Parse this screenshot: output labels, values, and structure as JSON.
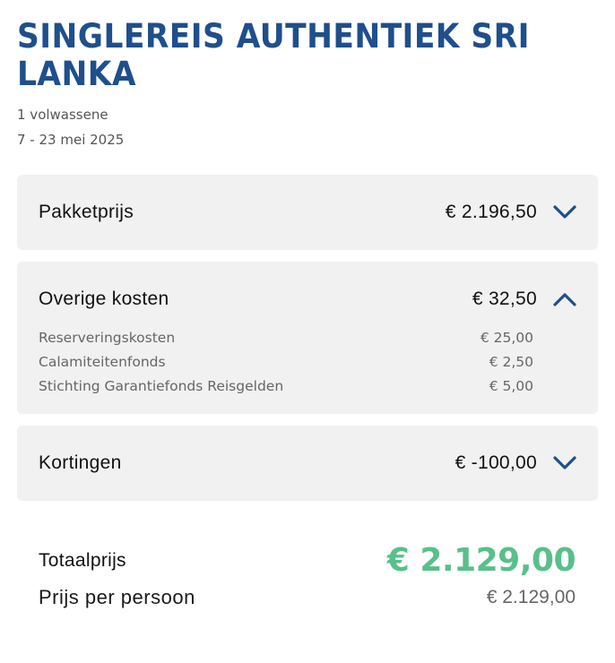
{
  "trip": {
    "title": "SINGLEREIS AUTHENTIEK SRI LANKA",
    "travelers": "1 volwassene",
    "dates": "7 - 23 mei 2025"
  },
  "sections": [
    {
      "label": "Pakketprijs",
      "amount": "€ 2.196,50",
      "expanded": false,
      "icon": "chevron-down-icon"
    },
    {
      "label": "Overige kosten",
      "amount": "€ 32,50",
      "expanded": true,
      "icon": "chevron-up-icon",
      "items": [
        {
          "label": "Reserveringskosten",
          "amount": "€ 25,00"
        },
        {
          "label": "Calamiteitenfonds",
          "amount": "€ 2,50"
        },
        {
          "label": "Stichting Garantiefonds Reisgelden",
          "amount": "€ 5,00"
        }
      ]
    },
    {
      "label": "Kortingen",
      "amount": "€ -100,00",
      "expanded": false,
      "icon": "chevron-down-icon"
    }
  ],
  "totals": {
    "total_label": "Totaalprijs",
    "total_amount": "€ 2.129,00",
    "per_person_label": "Prijs per persoon",
    "per_person_amount": "€ 2.129,00"
  },
  "colors": {
    "title": "#1f4f8c",
    "chevron": "#1f4f8c",
    "total": "#58c08a",
    "card_background": "#f1f1f1"
  }
}
